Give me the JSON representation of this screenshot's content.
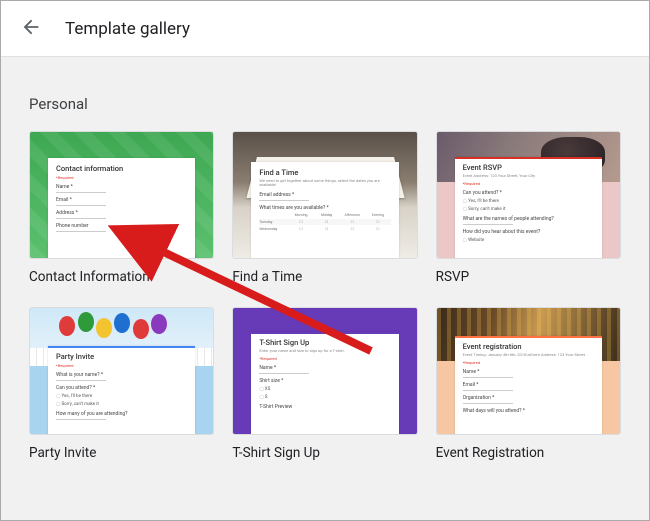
{
  "header": {
    "title": "Template gallery"
  },
  "section": {
    "label": "Personal"
  },
  "templates": [
    {
      "caption": "Contact Information",
      "bg": "#3cba54",
      "accent": "#3cba54",
      "form_title": "Contact information",
      "fields": [
        "Name *",
        "Email *",
        "Address *",
        "Phone number"
      ]
    },
    {
      "caption": "Find a Time",
      "bg": "photo-books",
      "accent": "#555",
      "form_title": "Find a Time",
      "sub": "We need to get together about some things, select the dates you are available!",
      "fields_label": "Email address *",
      "grid_label": "What times are you available? *",
      "grid_cols": [
        "Morning",
        "Midday",
        "Afternoon",
        "Evening"
      ],
      "grid_rows": [
        "Tuesday",
        "Wednesday"
      ]
    },
    {
      "caption": "RSVP",
      "bg": "photo-party",
      "bg_color": "#ebc7c7",
      "accent": "#d93025",
      "form_title": "Event RSVP",
      "sub": "Event Address: 123 Your Street, Your City",
      "q1": "Can you attend? *",
      "opts1": [
        "Yes, I'll be there",
        "Sorry, can't make it"
      ],
      "q2": "What are the names of people attending?",
      "q3": "How did you hear about this event?",
      "opt3": "Website"
    },
    {
      "caption": "Party Invite",
      "bg": "photo-balloons",
      "bg_color": "#a9d1ef",
      "accent": "#4285f4",
      "form_title": "Party Invite",
      "q1": "What is your name? *",
      "q2": "Can you attend? *",
      "opts2": [
        "Yes, I'll be there",
        "Sorry, can't make it"
      ],
      "q3": "How many of you are attending?"
    },
    {
      "caption": "T-Shirt Sign Up",
      "bg": "#673ab7",
      "accent": "#673ab7",
      "form_title": "T-Shirt Sign Up",
      "sub": "Enter your name and size to sign up for a T-shirt.",
      "fields": [
        "Name *",
        "Shirt size *"
      ],
      "sizes": [
        "XS",
        "S"
      ],
      "extra": "T-Shirt Preview"
    },
    {
      "caption": "Event Registration",
      "bg": "photo-city",
      "bg_color": "#f7c7a3",
      "accent": "#ff7043",
      "form_title": "Event registration",
      "sub": "Event Timing: January 4th-6th, 2016\\nEvent Address: 123 Your Street",
      "fields": [
        "Name *",
        "Email *",
        "Organization *"
      ],
      "extra": "What days will you attend? *"
    }
  ],
  "arrow": {
    "note": "annotation-arrow"
  }
}
